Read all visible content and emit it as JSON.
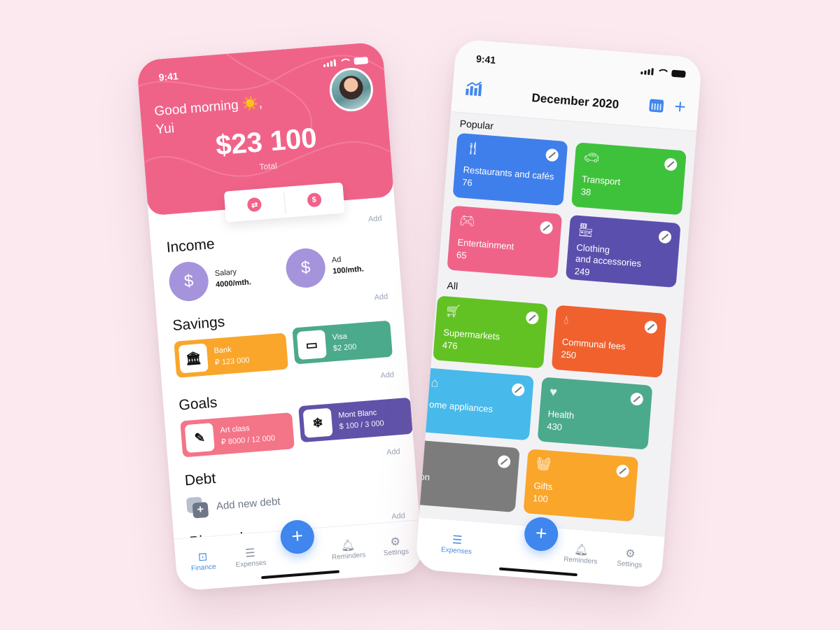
{
  "finance": {
    "status_time": "9:41",
    "greeting": "Good morning ☀️,",
    "user_name": "Yui",
    "total_amount": "$23 100",
    "total_label": "Total",
    "actions": {
      "transfer_icon": "⇄",
      "dollar_icon": "$"
    },
    "income": {
      "title": "Income",
      "add": "Add",
      "items": [
        {
          "name": "Salary",
          "amount": "4000/mth."
        },
        {
          "name": "Ad",
          "amount": "100/mth."
        }
      ]
    },
    "savings": {
      "title": "Savings",
      "add": "Add",
      "items": [
        {
          "name": "Bank",
          "amount": "₽ 123 000",
          "color": "#f9a62b"
        },
        {
          "name": "Visa",
          "amount": "$2 200",
          "color": "#4caa8c"
        }
      ]
    },
    "goals": {
      "title": "Goals",
      "add": "Add",
      "items": [
        {
          "name": "Art class",
          "amount": "₽ 8000 / 12 000",
          "color": "#f47488"
        },
        {
          "name": "Mont Blanc",
          "amount": "$ 100 / 3 000",
          "color": "#5f52a8"
        }
      ]
    },
    "debt": {
      "title": "Debt",
      "add": "Add",
      "add_new": "Add new debt"
    },
    "planned": {
      "title": "Planned spending",
      "add": "Add"
    },
    "tabs": [
      "Finance",
      "Expenses",
      "Reminders",
      "Settings"
    ]
  },
  "expenses": {
    "status_time": "9:41",
    "month": "December 2020",
    "popular_label": "Popular",
    "all_label": "All",
    "popular": [
      {
        "name": "Restaurants and cafés",
        "count": "76",
        "icon": "fork-knife-icon",
        "color": "#3f7fec"
      },
      {
        "name": "Transport",
        "count": "38",
        "icon": "car-icon",
        "color": "#3fc23b"
      },
      {
        "name": "Entertainment",
        "count": "65",
        "icon": "gamepad-icon",
        "color": "#f06389"
      },
      {
        "name": "Clothing\nand accessories",
        "count": "249",
        "icon": "store-icon",
        "color": "#5b4fae"
      }
    ],
    "all": [
      {
        "name": "Supermarkets",
        "count": "476",
        "icon": "cart-icon",
        "color": "#62c224"
      },
      {
        "name": "Communal fees",
        "count": "250",
        "icon": "drop-icon",
        "color": "#f0612e"
      },
      {
        "name": "ome appliances",
        "count": "",
        "icon": "home-icon",
        "color": "#47b9ea"
      },
      {
        "name": "Health",
        "count": "430",
        "icon": "heart-icon",
        "color": "#4caa8c"
      },
      {
        "name": "tion",
        "count": "",
        "icon": "",
        "color": "#7c7c7c"
      },
      {
        "name": "Gifts",
        "count": "100",
        "icon": "basket-icon",
        "color": "#f9a62b"
      }
    ],
    "tabs": [
      "Expenses",
      "Reminders",
      "Settings"
    ]
  }
}
